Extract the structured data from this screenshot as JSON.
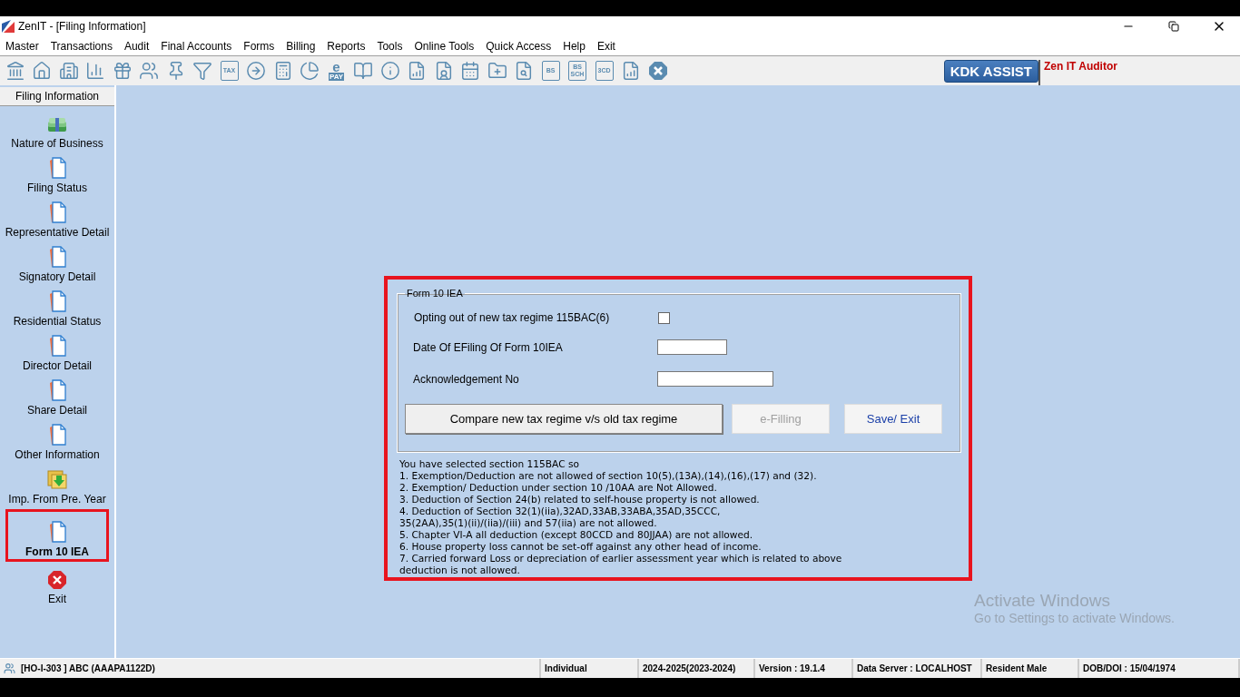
{
  "window": {
    "title": "ZenIT - [Filing Information]"
  },
  "menu": [
    {
      "label": "Master"
    },
    {
      "label": "Transactions"
    },
    {
      "label": "Audit"
    },
    {
      "label": "Final Accounts"
    },
    {
      "label": "Forms"
    },
    {
      "label": "Billing"
    },
    {
      "label": "Reports"
    },
    {
      "label": "Tools"
    },
    {
      "label": "Online Tools"
    },
    {
      "label": "Quick Access"
    },
    {
      "label": "Help"
    },
    {
      "label": "Exit"
    }
  ],
  "toolbar": [
    {
      "kind": "icon"
    },
    {
      "kind": "icon"
    },
    {
      "kind": "icon"
    },
    {
      "kind": "icon"
    },
    {
      "kind": "icon"
    },
    {
      "kind": "icon"
    },
    {
      "kind": "icon"
    },
    {
      "kind": "icon"
    },
    {
      "kind": "labeled",
      "text": "TAX"
    },
    {
      "kind": "icon"
    },
    {
      "kind": "icon"
    },
    {
      "kind": "icon"
    },
    {
      "kind": "pay",
      "text": "e",
      "subtext": "PAY"
    },
    {
      "kind": "icon"
    },
    {
      "kind": "icon"
    },
    {
      "kind": "icon"
    },
    {
      "kind": "icon"
    },
    {
      "kind": "icon"
    },
    {
      "kind": "icon"
    },
    {
      "kind": "icon"
    },
    {
      "kind": "labeled",
      "text": "BS"
    },
    {
      "kind": "labeled",
      "text": "BS",
      "subtext": "SCH"
    },
    {
      "kind": "labeled",
      "text": "3CD"
    },
    {
      "kind": "icon"
    },
    {
      "kind": "close"
    }
  ],
  "assist_button": "KDK ASSIST",
  "brand_text": "Zen IT Auditor",
  "sidebar": {
    "title": "Filing Information",
    "items": [
      {
        "label": "Nature of Business",
        "kind": "money",
        "selected": false,
        "highlighted": false
      },
      {
        "label": "Filing Status",
        "kind": "doc",
        "selected": false,
        "highlighted": false
      },
      {
        "label": "Representative Detail",
        "kind": "doc",
        "selected": false,
        "highlighted": false
      },
      {
        "label": "Signatory Detail",
        "kind": "doc",
        "selected": false,
        "highlighted": false
      },
      {
        "label": "Residential Status",
        "kind": "doc",
        "selected": false,
        "highlighted": false
      },
      {
        "label": "Director Detail",
        "kind": "doc",
        "selected": false,
        "highlighted": false
      },
      {
        "label": "Share Detail",
        "kind": "doc",
        "selected": false,
        "highlighted": false
      },
      {
        "label": "Other Information",
        "kind": "doc",
        "selected": false,
        "highlighted": false
      },
      {
        "label": "Imp. From Pre. Year",
        "kind": "import",
        "selected": false,
        "highlighted": false
      },
      {
        "label": "Form 10 IEA",
        "kind": "doc",
        "selected": true,
        "highlighted": true
      }
    ],
    "exit": {
      "label": "Exit"
    }
  },
  "form": {
    "highlighted": true,
    "group_title": "Form 10 IEA",
    "opt_out": {
      "label": "Opting out of new tax regime 115BAC(6)",
      "checked": false
    },
    "fields": [
      {
        "label": "Date Of EFiling Of Form 10IEA",
        "kind": "short"
      },
      {
        "label": "Acknowledgement No",
        "kind": "long"
      }
    ],
    "buttons": [
      {
        "label": "Compare new tax regime v/s old tax regime",
        "kind": "plain",
        "disabled": false
      },
      {
        "label": "e-Filling",
        "kind": "link",
        "disabled": true
      },
      {
        "label": "Save/ Exit",
        "kind": "link",
        "disabled": false
      }
    ],
    "notes": [
      "You have selected section 115BAC so",
      "1. Exemption/Deduction are not allowed of section 10(5),(13A),(14),(16),(17) and (32).",
      "2. Exemption/ Deduction under section 10 /10AA are Not Allowed.",
      "3. Deduction of Section 24(b) related to self-house property is not allowed.",
      "4. Deduction of Section 32(1)(iia),32AD,33AB,33ABA,35AD,35CCC,",
      "35(2AA),35(1)(ii)/(iia)/(iii) and 57(iia) are not allowed.",
      "5. Chapter VI-A all deduction (except 80CCD and 80JJAA) are not allowed.",
      "6. House property loss cannot be set-off against any other head of income.",
      "7. Carried forward Loss or depreciation of earlier assessment year which is related to  above",
      "deduction is not allowed."
    ]
  },
  "watermark": {
    "title": "Activate Windows",
    "subtitle": "Go to Settings to activate Windows."
  },
  "status_bar": [
    "[HO-I-303 ] ABC (AAAPA1122D)",
    "Individual",
    "2024-2025(2023-2024)",
    "Version : 19.1.4",
    "Data Server : LOCALHOST",
    "Resident Male",
    "DOB/DOI : 15/04/1974"
  ]
}
